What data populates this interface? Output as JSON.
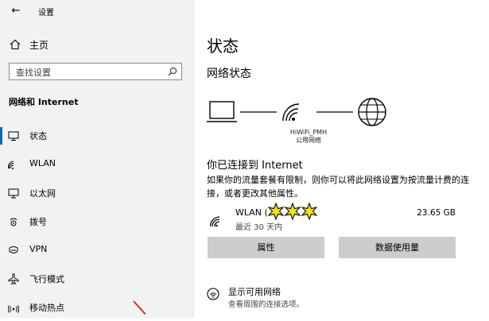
{
  "window": {
    "back_glyph": "←",
    "app_title": "设置"
  },
  "sidebar": {
    "home_label": "主页",
    "search_placeholder": "查找设置",
    "category": "网络和 Internet",
    "items": [
      {
        "label": "状态",
        "icon": "status-icon",
        "active": true
      },
      {
        "label": "WLAN",
        "icon": "wifi-icon",
        "active": false
      },
      {
        "label": "以太网",
        "icon": "ethernet-icon",
        "active": false
      },
      {
        "label": "拨号",
        "icon": "dialup-icon",
        "active": false
      },
      {
        "label": "VPN",
        "icon": "vpn-icon",
        "active": false
      },
      {
        "label": "飞行模式",
        "icon": "airplane-icon",
        "active": false
      },
      {
        "label": "移动热点",
        "icon": "hotspot-icon",
        "active": false
      }
    ]
  },
  "main": {
    "title": "状态",
    "network_status_heading": "网络状态",
    "network": {
      "name": "HiWiFi_PMH",
      "type": "公用网络"
    },
    "connected_heading": "你已连接到 Internet",
    "connected_desc": "如果你的流量套餐有限制，则你可以将此网络设置为按流量计费的连接，或者更改其他属性。",
    "connection": {
      "name": "WLAN (",
      "mask_text": "✱✱✱",
      "subtitle": "最近 30 天内",
      "usage": "23.65 GB"
    },
    "buttons": {
      "properties": "属性",
      "data_usage": "数据使用量"
    },
    "show_networks": {
      "title": "显示可用网络",
      "subtitle": "查看周围的连接选项。"
    }
  },
  "colors": {
    "accent": "#0067c0",
    "sidebar_bg": "#f2f2f2",
    "button_bg": "#cccccc",
    "annotation_arrow": "#d6342a",
    "mask_yellow": "#f5e600"
  }
}
